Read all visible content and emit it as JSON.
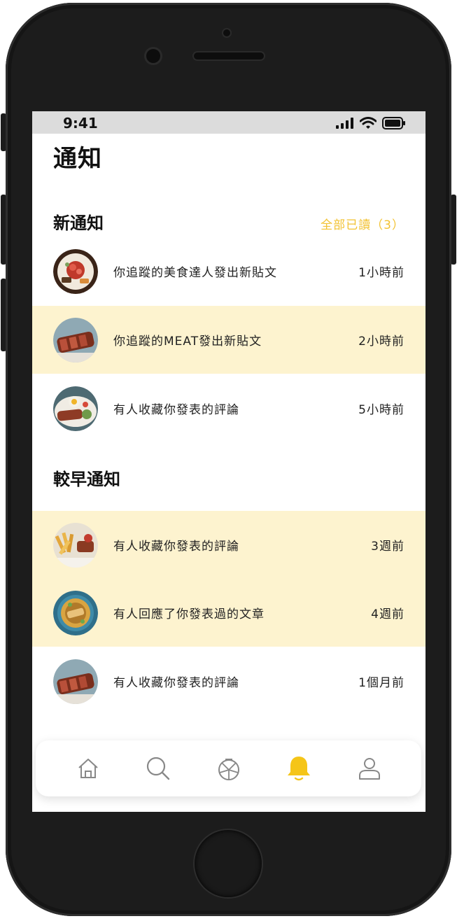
{
  "status": {
    "time": "9:41"
  },
  "page": {
    "title": "通知"
  },
  "new_section": {
    "title": "新通知",
    "mark_all_read": "全部已讀（3）",
    "items": [
      {
        "text": "你追蹤的美食達人發出新貼文",
        "time": "1小時前",
        "highlighted": false
      },
      {
        "text": "你追蹤的MEAT發出新貼文",
        "time": "2小時前",
        "highlighted": true
      },
      {
        "text": "有人收藏你發表的評論",
        "time": "5小時前",
        "highlighted": false
      }
    ]
  },
  "earlier_section": {
    "title": "較早通知",
    "items": [
      {
        "text": "有人收藏你發表的評論",
        "time": "3週前",
        "highlighted": true
      },
      {
        "text": "有人回應了你發表過的文章",
        "time": "4週前",
        "highlighted": true
      },
      {
        "text": "有人收藏你發表的評論",
        "time": "1個月前",
        "highlighted": false
      }
    ]
  },
  "tabbar": {
    "items": [
      {
        "icon": "home-icon",
        "active": false
      },
      {
        "icon": "search-icon",
        "active": false
      },
      {
        "icon": "pizza-icon",
        "active": false
      },
      {
        "icon": "bell-icon",
        "active": true
      },
      {
        "icon": "user-icon",
        "active": false
      }
    ]
  },
  "colors": {
    "accent": "#f5c518",
    "highlight": "#fdf3cf",
    "icon_inactive": "#888888",
    "statusbar": "#dcdcdc"
  }
}
